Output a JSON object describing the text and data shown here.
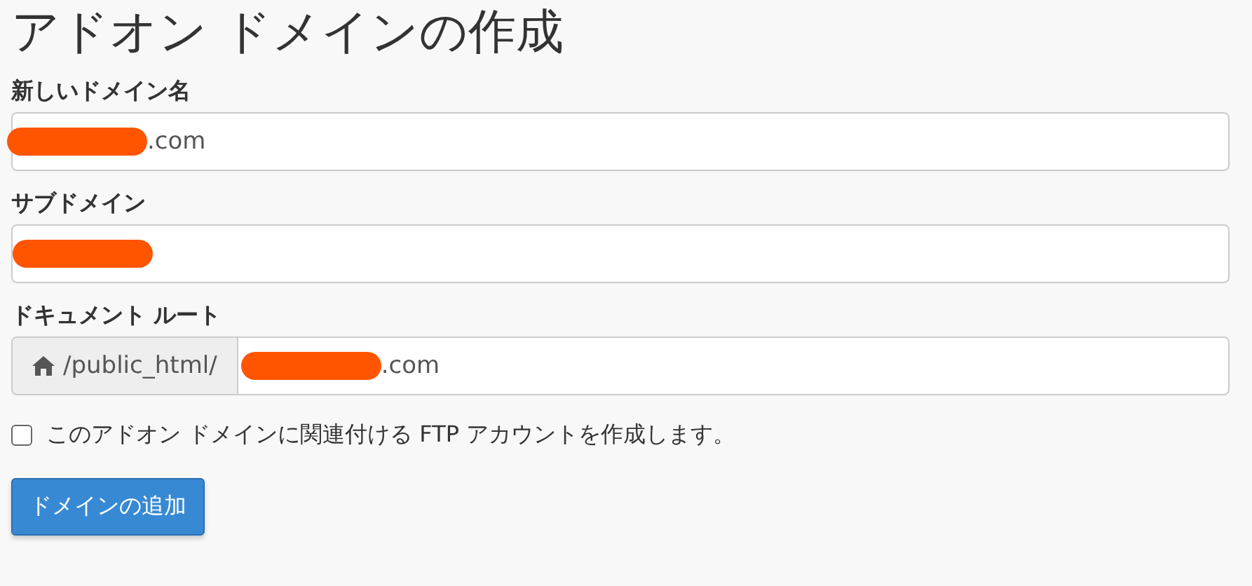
{
  "title": "アドオン ドメインの作成",
  "fields": [
    {
      "label": "新しいドメイン名",
      "redacted": true,
      "value": ".com"
    },
    {
      "label": "サブドメイン",
      "redacted": true
    },
    {
      "label": "ドキュメント ルート",
      "prefix": "/public_html/",
      "redacted": true,
      "value": ".com"
    }
  ],
  "ftp_checkbox": {
    "label": "このアドオン ドメインに関連付ける FTP アカウントを作成します。",
    "checked": false
  },
  "submit_button": "ドメインの追加"
}
